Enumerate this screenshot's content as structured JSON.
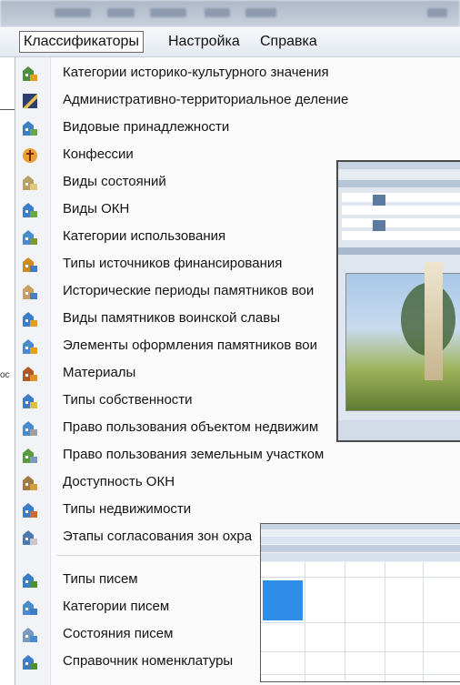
{
  "menubar": {
    "items": [
      "Классификаторы",
      "Настройка",
      "Справка"
    ]
  },
  "menu": {
    "items": [
      {
        "label": "Категории историко-культурного значения",
        "icon": "people-group-icon"
      },
      {
        "label": "Административно-территориальное деление",
        "icon": "map-diagonal-icon"
      },
      {
        "label": "Видовые принадлежности",
        "icon": "building-tree-icon"
      },
      {
        "label": "Конфессии",
        "icon": "cross-icon"
      },
      {
        "label": "Виды состояний",
        "icon": "columns-building-icon"
      },
      {
        "label": "Виды ОКН",
        "icon": "building-tree-icon"
      },
      {
        "label": "Категории использования",
        "icon": "tools-icon"
      },
      {
        "label": "Типы источников финансирования",
        "icon": "money-building-icon"
      },
      {
        "label": "Исторические периоды памятников вои",
        "icon": "monument-icon"
      },
      {
        "label": "Виды памятников воинской славы",
        "icon": "people-building-icon"
      },
      {
        "label": "Элементы оформления памятников вои",
        "icon": "tiles-icon"
      },
      {
        "label": "Материалы",
        "icon": "bricks-icon"
      },
      {
        "label": "Типы собственности",
        "icon": "key-building-icon"
      },
      {
        "label": "Право пользования объектом недвижим",
        "icon": "document-building-icon"
      },
      {
        "label": "Право пользования земельным участком",
        "icon": "land-document-icon"
      },
      {
        "label": "Доступность ОКН",
        "icon": "lock-building-icon"
      },
      {
        "label": "Типы недвижимости",
        "icon": "house-building-icon"
      },
      {
        "label": "Этапы согласования зон охра",
        "icon": "stamp-document-icon"
      },
      {
        "label": "Типы писем",
        "icon": "letter-type-icon"
      },
      {
        "label": "Категории писем",
        "icon": "letter-category-icon"
      },
      {
        "label": "Состояния писем",
        "icon": "letter-status-icon"
      },
      {
        "label": "Справочник номенклатуры",
        "icon": "directory-icon"
      }
    ]
  },
  "colors": {
    "menubar_bg": "#e9edf3",
    "selection": "#2e8de8"
  }
}
